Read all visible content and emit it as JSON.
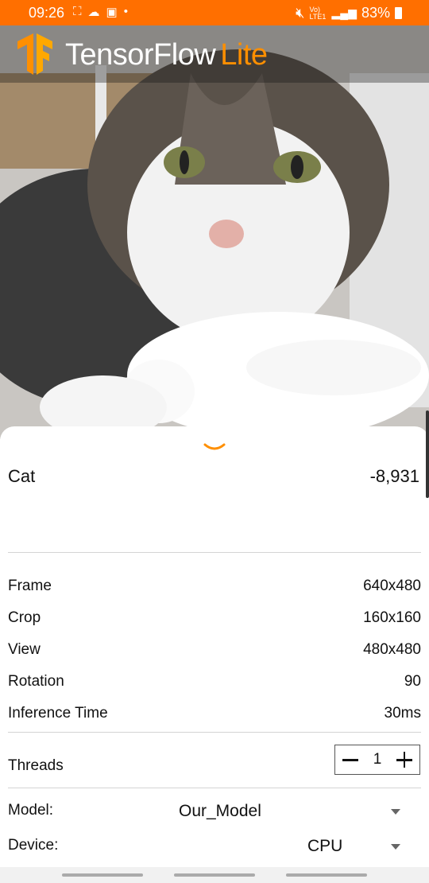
{
  "status_bar": {
    "time": "09:26",
    "battery": "83%",
    "network": "Vo) LTE1"
  },
  "header": {
    "title": "TensorFlow",
    "title_suffix": "Lite",
    "accent_color": "#ff8f00"
  },
  "result": {
    "label": "Cat",
    "score": "-8,931"
  },
  "info": [
    {
      "label": "Frame",
      "value": "640x480"
    },
    {
      "label": "Crop",
      "value": "160x160"
    },
    {
      "label": "View",
      "value": "480x480"
    },
    {
      "label": "Rotation",
      "value": "90"
    },
    {
      "label": "Inference Time",
      "value": "30ms"
    }
  ],
  "threads": {
    "label": "Threads",
    "value": "1"
  },
  "model": {
    "label": "Model:",
    "selected": "Our_Model"
  },
  "device": {
    "label": "Device:",
    "selected": "CPU"
  }
}
